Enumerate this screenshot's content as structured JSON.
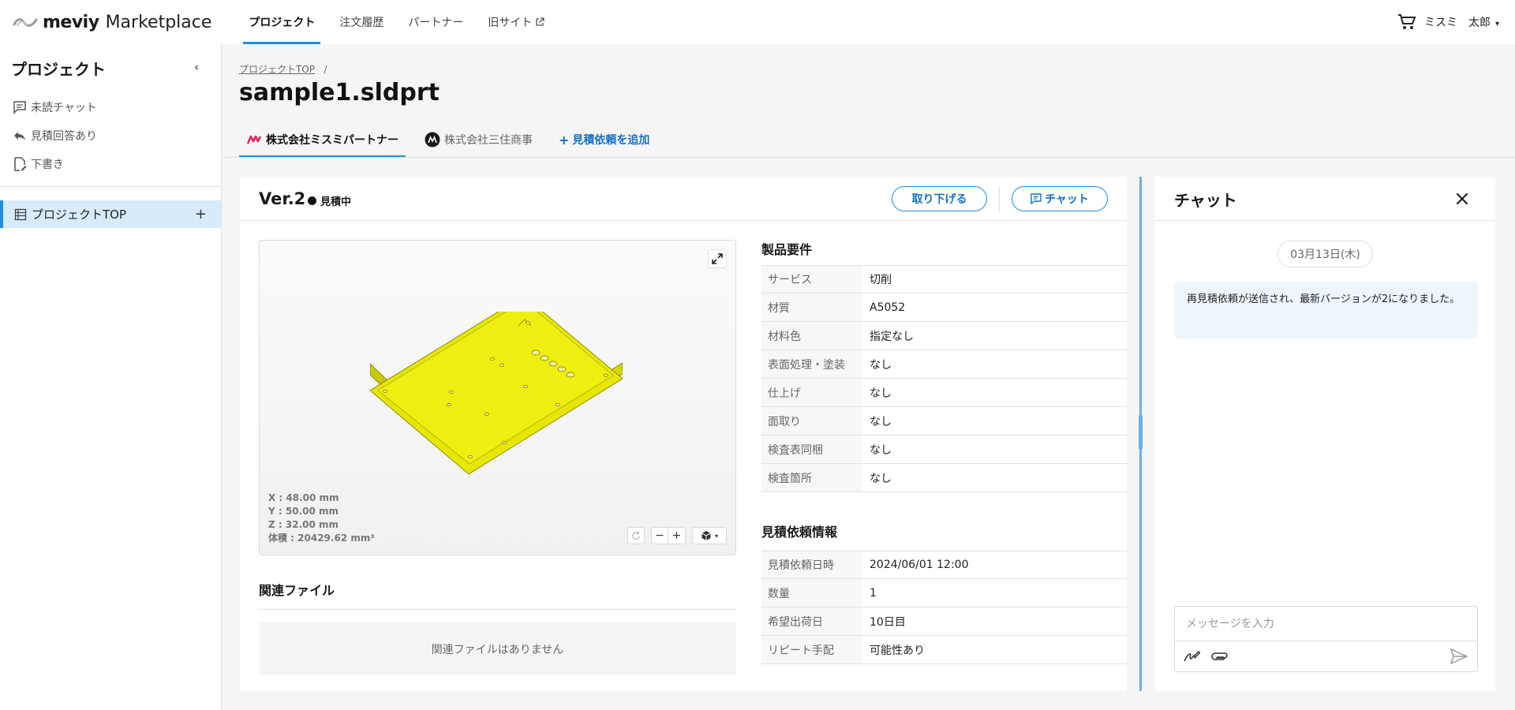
{
  "app": {
    "logo_text": "meviy",
    "logo_sub": "Marketplace"
  },
  "nav": [
    {
      "label": "プロジェクト"
    },
    {
      "label": "注文履歴"
    },
    {
      "label": "パートナー"
    },
    {
      "label": "旧サイト"
    }
  ],
  "user": {
    "company": "ミスミ",
    "name": "太郎"
  },
  "sidebar": {
    "title": "プロジェクト",
    "items": [
      {
        "label": "未読チャット"
      },
      {
        "label": "見積回答あり"
      },
      {
        "label": "下書き"
      }
    ],
    "project": {
      "label": "プロジェクトTOP"
    }
  },
  "breadcrumb": {
    "link": "プロジェクトTOP",
    "sep": "/"
  },
  "page": {
    "title": "sample1.sldprt"
  },
  "tabs": [
    {
      "label": "株式会社ミスミパートナー"
    },
    {
      "label": "株式会社三住商事"
    },
    {
      "label": "見積依頼を追加"
    }
  ],
  "version": {
    "label": "Ver.2",
    "status": "見積中",
    "withdraw_label": "取り下げる",
    "chat_label": "チャット"
  },
  "viewer": {
    "x": "X : 48.00 mm",
    "y": "Y : 50.00 mm",
    "z": "Z : 32.00 mm",
    "volume": "体積 : 20429.62 mm³",
    "part_color": "#e6e600",
    "zoom_out": "−",
    "zoom_in": "+"
  },
  "related": {
    "title": "関連ファイル",
    "empty": "関連ファイルはありません"
  },
  "product_req": {
    "title": "製品要件",
    "rows": [
      {
        "label": "サービス",
        "value": "切削"
      },
      {
        "label": "材質",
        "value": "A5052"
      },
      {
        "label": "材料色",
        "value": "指定なし"
      },
      {
        "label": "表面処理・塗装",
        "value": "なし"
      },
      {
        "label": "仕上げ",
        "value": "なし"
      },
      {
        "label": "面取り",
        "value": "なし"
      },
      {
        "label": "検査表同梱",
        "value": "なし"
      },
      {
        "label": "検査箇所",
        "value": "なし"
      }
    ]
  },
  "quote_info": {
    "title": "見積依頼情報",
    "rows": [
      {
        "label": "見積依頼日時",
        "value": "2024/06/01 12:00"
      },
      {
        "label": "数量",
        "value": "1"
      },
      {
        "label": "希望出荷日",
        "value": "10日目"
      },
      {
        "label": "リピート手配",
        "value": "可能性あり"
      }
    ]
  },
  "chat": {
    "title": "チャット",
    "date": "03月13日(木)",
    "message": "再見積依頼が送信され、最新バージョンが2になりました。",
    "placeholder": "メッセージを入力"
  },
  "colors": {
    "accent": "#1b8fe6",
    "link": "#1570c5"
  }
}
